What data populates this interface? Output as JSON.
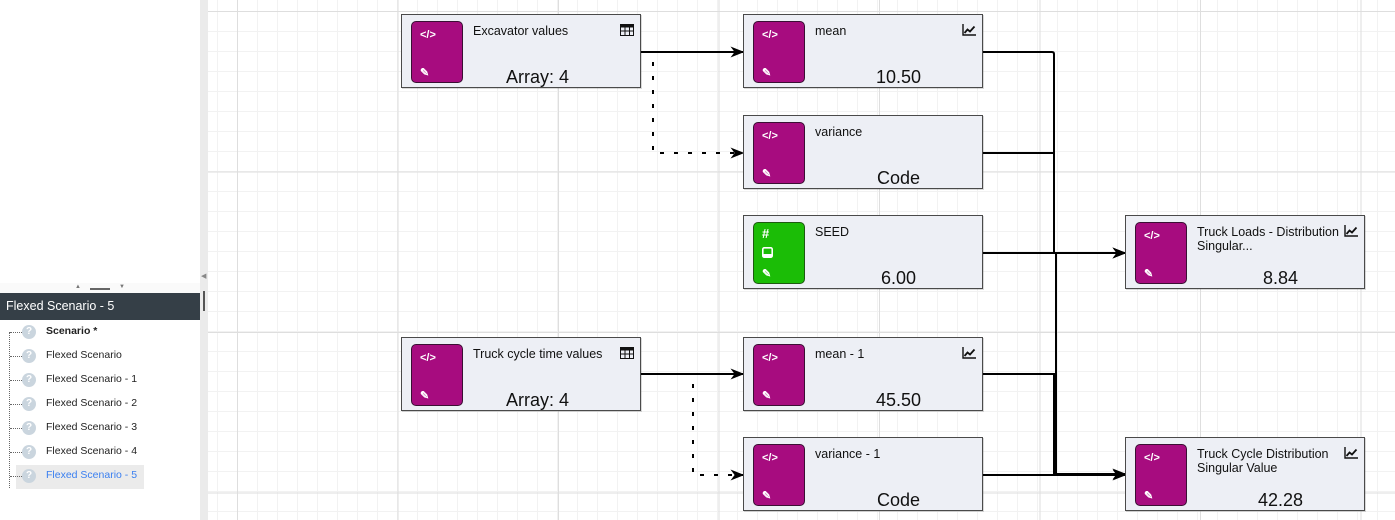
{
  "sidebar": {
    "panel_title": "Flexed Scenario - 5",
    "tree_items": [
      {
        "label": "Scenario *",
        "icon": "help-circle-icon",
        "bold": true,
        "selected": false
      },
      {
        "label": "Flexed Scenario",
        "icon": "help-circle-icon",
        "bold": false,
        "selected": false
      },
      {
        "label": "Flexed Scenario - 1",
        "icon": "help-circle-icon",
        "bold": false,
        "selected": false
      },
      {
        "label": "Flexed Scenario - 2",
        "icon": "help-circle-icon",
        "bold": false,
        "selected": false
      },
      {
        "label": "Flexed Scenario - 3",
        "icon": "help-circle-icon",
        "bold": false,
        "selected": false
      },
      {
        "label": "Flexed Scenario - 4",
        "icon": "help-circle-icon",
        "bold": false,
        "selected": false
      },
      {
        "label": "Flexed Scenario - 5",
        "icon": "help-circle-icon",
        "bold": false,
        "selected": true
      }
    ],
    "question_glyph": "?",
    "splitter_up": "▲",
    "splitter_down": "▼",
    "collapse_glyph": "◀"
  },
  "colors": {
    "code_badge": "#a70c7f",
    "number_badge": "#1bbd06",
    "node_bg": "#edeff5",
    "panel_header": "#353f47",
    "selected_text": "#3a7ff0"
  },
  "nodes": {
    "excavator_values": {
      "title": "Excavator values",
      "value": "Array:  4",
      "badge": "code",
      "type_icon": "table-icon"
    },
    "mean": {
      "title": "mean",
      "value": "10.50",
      "badge": "code",
      "type_icon": "chart-line-icon"
    },
    "variance": {
      "title": "variance",
      "value": "Code",
      "badge": "code",
      "type_icon": ""
    },
    "seed": {
      "title": "SEED",
      "value": "6.00",
      "badge": "number",
      "type_icon": ""
    },
    "truck_loads": {
      "title": "Truck Loads - Distribution Singular...",
      "value": "8.84",
      "badge": "code",
      "type_icon": "chart-line-icon"
    },
    "truck_cycle_time_values": {
      "title": "Truck cycle time values",
      "value": "Array:  4",
      "badge": "code",
      "type_icon": "table-icon"
    },
    "mean_1": {
      "title": "mean - 1",
      "value": "45.50",
      "badge": "code",
      "type_icon": "chart-line-icon"
    },
    "variance_1": {
      "title": "variance - 1",
      "value": "Code",
      "badge": "code",
      "type_icon": ""
    },
    "truck_cycle_distribution": {
      "title": "Truck Cycle Distribution Singular Value",
      "value": "42.28",
      "badge": "code",
      "type_icon": "chart-line-icon"
    }
  },
  "badge_icons": {
    "code": "</>",
    "hash": "#",
    "edit": "✎"
  },
  "edges": [
    {
      "from": "excavator_values",
      "to": "mean",
      "style": "solid"
    },
    {
      "from": "excavator_values",
      "to": "variance",
      "style": "dashed"
    },
    {
      "from": "truck_cycle_time_values",
      "to": "mean_1",
      "style": "solid"
    },
    {
      "from": "truck_cycle_time_values",
      "to": "variance_1",
      "style": "dashed"
    },
    {
      "from": "mean",
      "to": "truck_loads",
      "style": "solid"
    },
    {
      "from": "variance",
      "to": "truck_loads",
      "style": "solid"
    },
    {
      "from": "seed",
      "to": "truck_loads",
      "style": "solid"
    },
    {
      "from": "mean_1",
      "to": "truck_cycle_distribution",
      "style": "solid"
    },
    {
      "from": "variance_1",
      "to": "truck_cycle_distribution",
      "style": "solid"
    }
  ]
}
